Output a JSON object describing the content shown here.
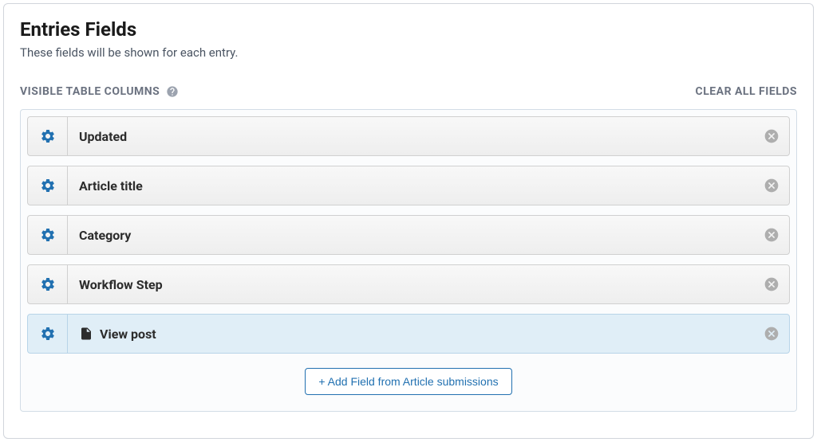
{
  "header": {
    "title": "Entries Fields",
    "subtitle": "These fields will be shown for each entry."
  },
  "columns": {
    "label": "VISIBLE TABLE COLUMNS",
    "clear_label": "CLEAR ALL FIELDS"
  },
  "fields": [
    {
      "label": "Updated",
      "has_icon": false,
      "highlighted": false
    },
    {
      "label": "Article title",
      "has_icon": false,
      "highlighted": false
    },
    {
      "label": "Category",
      "has_icon": false,
      "highlighted": false
    },
    {
      "label": "Workflow Step",
      "has_icon": false,
      "highlighted": false
    },
    {
      "label": "View post",
      "has_icon": true,
      "highlighted": true
    }
  ],
  "add_button": {
    "label": "+ Add Field from Article submissions"
  }
}
